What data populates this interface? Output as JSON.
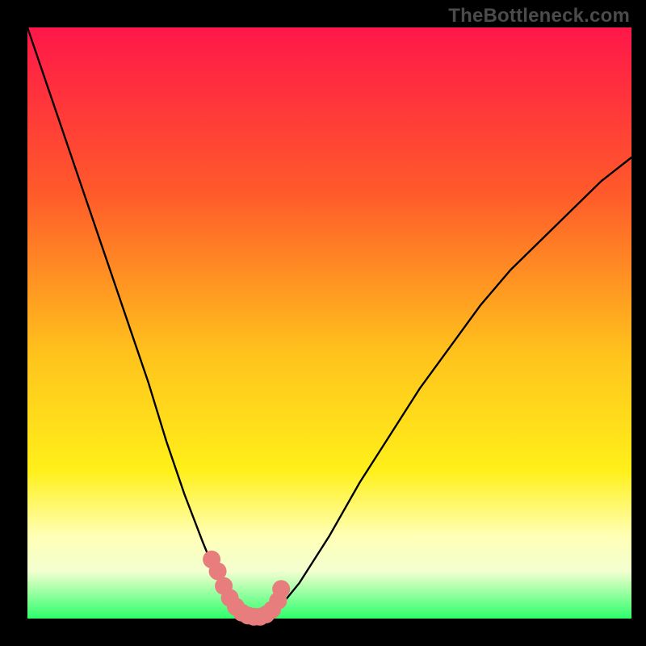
{
  "watermark": "TheBottleneck.com",
  "colors": {
    "black": "#000000",
    "gradient_top": "#ff1749",
    "gradient_mid1": "#ff7a1f",
    "gradient_mid2": "#ffe01a",
    "gradient_mid3": "#ffffb0",
    "gradient_bottom": "#2cff6a",
    "curve": "#000000",
    "dots": "#e77d7d"
  },
  "chart_data": {
    "type": "line",
    "title": "",
    "xlabel": "",
    "ylabel": "",
    "xlim": [
      0,
      100
    ],
    "ylim": [
      0,
      100
    ],
    "legend": false,
    "grid": false,
    "series": [
      {
        "name": "bottleneck-curve",
        "x": [
          0,
          5,
          10,
          15,
          20,
          23,
          26,
          29,
          31,
          33,
          35,
          37,
          39,
          41,
          45,
          50,
          55,
          60,
          65,
          70,
          75,
          80,
          85,
          90,
          95,
          100
        ],
        "values": [
          100,
          85,
          70,
          55,
          40,
          30,
          21,
          13,
          8,
          4,
          1,
          0,
          0,
          1,
          6,
          14,
          23,
          31,
          39,
          46,
          53,
          59,
          64,
          69,
          74,
          78
        ]
      }
    ],
    "highlight_points": {
      "name": "highlight-dots",
      "x": [
        30.5,
        31.5,
        32.5,
        33.5,
        34.5,
        35.5,
        36.5,
        37.5,
        38.5,
        39.5,
        40.5,
        41.5,
        42.0
      ],
      "values": [
        10,
        8,
        5.5,
        3.5,
        2,
        1,
        0.5,
        0.3,
        0.3,
        0.7,
        1.5,
        3,
        5
      ]
    }
  }
}
